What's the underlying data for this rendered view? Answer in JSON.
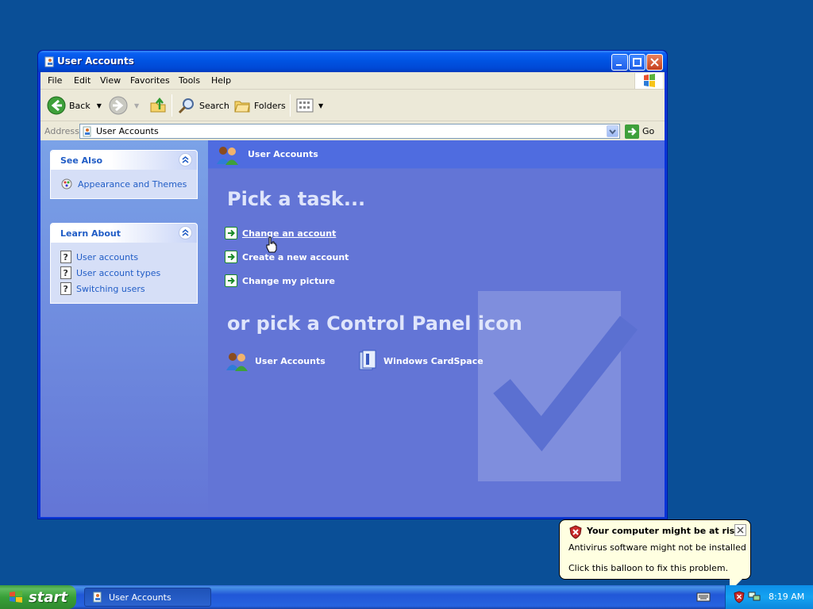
{
  "window": {
    "title": "User Accounts",
    "menu": [
      "File",
      "Edit",
      "View",
      "Favorites",
      "Tools",
      "Help"
    ],
    "toolbar": {
      "back_label": "Back",
      "search_label": "Search",
      "folders_label": "Folders"
    },
    "address": {
      "label": "Address",
      "value": "User Accounts",
      "go_label": "Go"
    }
  },
  "sidebar": {
    "see_also": {
      "title": "See Also",
      "items": [
        {
          "label": "Appearance and Themes",
          "icon": "appearance-themes-icon"
        }
      ]
    },
    "learn_about": {
      "title": "Learn About",
      "items": [
        {
          "label": "User accounts",
          "icon": "help-icon"
        },
        {
          "label": "User account types",
          "icon": "help-icon"
        },
        {
          "label": "Switching users",
          "icon": "help-icon"
        }
      ]
    }
  },
  "main": {
    "header_title": "User Accounts",
    "pick_task_heading": "Pick a task...",
    "tasks": [
      {
        "label": "Change an account",
        "active": true
      },
      {
        "label": "Create a new account",
        "active": false
      },
      {
        "label": "Change my picture",
        "active": false
      }
    ],
    "pick_icon_heading": "or pick a Control Panel icon",
    "icons": [
      {
        "label": "User Accounts",
        "icon": "user-accounts-icon"
      },
      {
        "label": "Windows CardSpace",
        "icon": "cardspace-icon"
      }
    ]
  },
  "balloon": {
    "title": "Your computer might be at risk",
    "line1": "Antivirus software might not be installed",
    "line2": "Click this balloon to fix this problem."
  },
  "taskbar": {
    "start_label": "start",
    "task_item": "User Accounts",
    "clock": "8:19 AM"
  },
  "colors": {
    "desktop": "#0a4f97",
    "content_bg": "#6375d6",
    "link": "#215dc6"
  }
}
